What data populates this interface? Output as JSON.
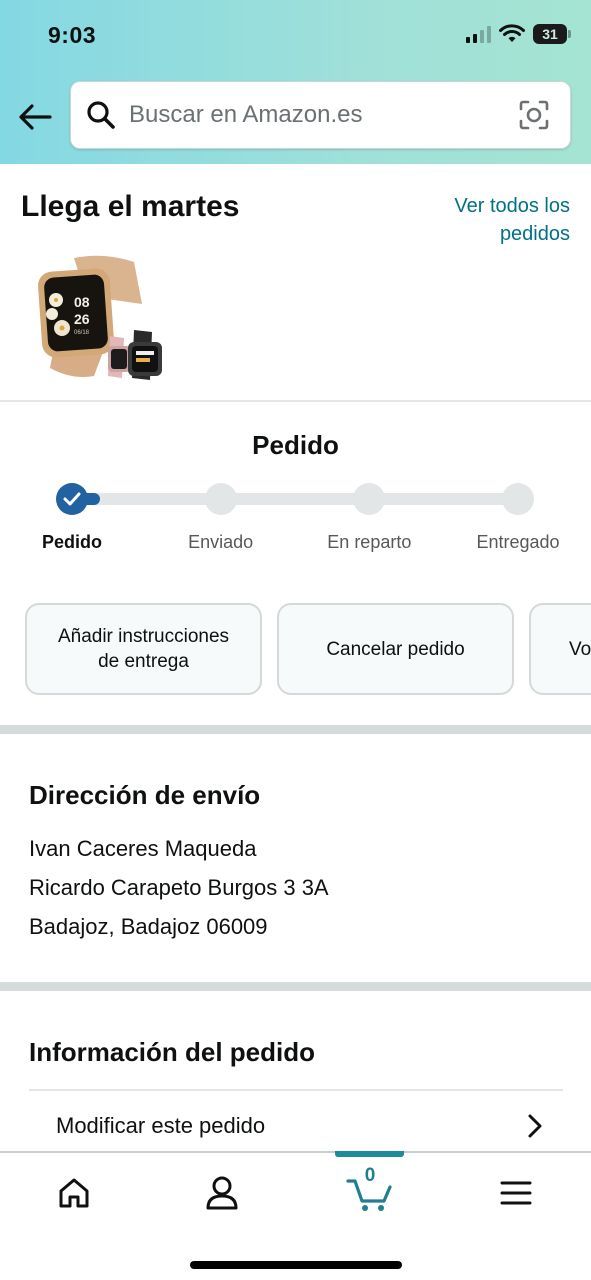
{
  "status_bar": {
    "time": "9:03",
    "battery": "31"
  },
  "search": {
    "placeholder": "Buscar en Amazon.es"
  },
  "arrival": {
    "title": "Llega el martes",
    "view_all_line1": "Ver todos los",
    "view_all_line2": "pedidos",
    "product_watch_time_hours": "08",
    "product_watch_time_minutes": "26",
    "product_watch_date": "06/18"
  },
  "progress": {
    "title": "Pedido",
    "current_step": 1,
    "steps": [
      {
        "label": "Pedido"
      },
      {
        "label": "Enviado"
      },
      {
        "label": "En reparto"
      },
      {
        "label": "Entregado"
      }
    ]
  },
  "actions": {
    "delivery_instructions_line1": "Añadir instrucciones",
    "delivery_instructions_line2": "de entrega",
    "cancel": "Cancelar pedido",
    "partial": "Vo"
  },
  "shipping": {
    "title": "Dirección de envío",
    "name": "Ivan Caceres Maqueda",
    "street": "Ricardo Carapeto Burgos 3 3A",
    "city": "Badajoz, Badajoz 06009"
  },
  "order_info": {
    "title": "Información del pedido",
    "modify": "Modificar este pedido"
  },
  "bottom_nav": {
    "cart_count": "0",
    "items": [
      "home-icon",
      "account-icon",
      "cart-icon",
      "menu-icon"
    ]
  },
  "colors": {
    "accent_blue": "#2162a1",
    "link_teal": "#007185",
    "cart_teal": "#1f8a9a"
  }
}
